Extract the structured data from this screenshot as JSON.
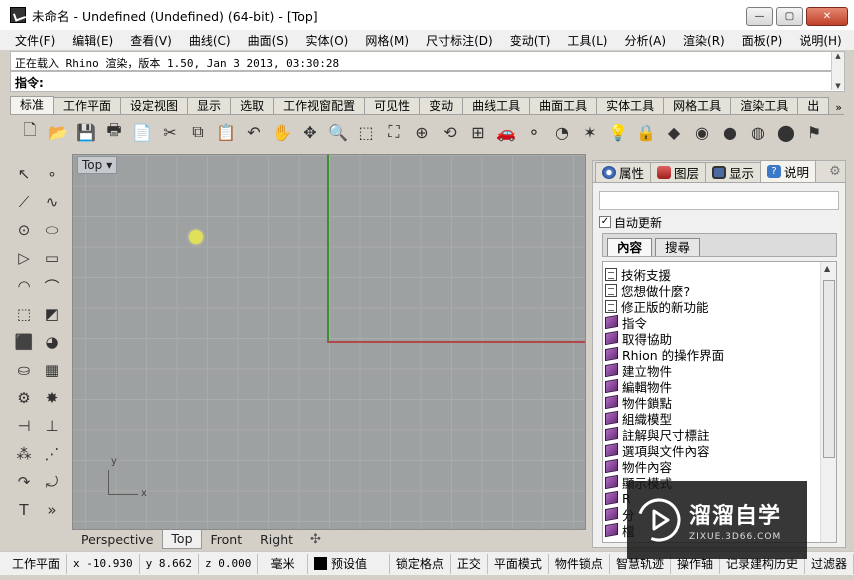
{
  "window": {
    "title": "未命名 - Undefined (Undefined) (64-bit) - [Top]",
    "buttons": {
      "minimize": "—",
      "maximize": "▢",
      "close": "✕"
    }
  },
  "menu": [
    "文件(F)",
    "编辑(E)",
    "查看(V)",
    "曲线(C)",
    "曲面(S)",
    "实体(O)",
    "网格(M)",
    "尺寸标注(D)",
    "变动(T)",
    "工具(L)",
    "分析(A)",
    "渲染(R)",
    "面板(P)",
    "说明(H)"
  ],
  "command": {
    "history": "正在载入 Rhino 渲染，版本 1.50, Jan  3 2013, 03:30:28",
    "prompt": "指令:"
  },
  "toolbar_tabs": {
    "items": [
      "标准",
      "工作平面",
      "设定视图",
      "显示",
      "选取",
      "工作视窗配置",
      "可见性",
      "变动",
      "曲线工具",
      "曲面工具",
      "实体工具",
      "网格工具",
      "渲染工具",
      "出"
    ],
    "active": "标准",
    "more": "»"
  },
  "main_tools": [
    {
      "name": "new-icon",
      "glyph": "🗋"
    },
    {
      "name": "open-icon",
      "glyph": "📂"
    },
    {
      "name": "save-icon",
      "glyph": "💾"
    },
    {
      "name": "print-icon",
      "glyph": "🖶"
    },
    {
      "name": "import-icon",
      "glyph": "📄"
    },
    {
      "name": "cut-icon",
      "glyph": "✂"
    },
    {
      "name": "copy-icon",
      "glyph": "⧉"
    },
    {
      "name": "paste-icon",
      "glyph": "📋"
    },
    {
      "name": "undo-icon",
      "glyph": "↶"
    },
    {
      "name": "pan-icon",
      "glyph": "✋"
    },
    {
      "name": "rotate-view-icon",
      "glyph": "✥"
    },
    {
      "name": "zoom-icon",
      "glyph": "🔍"
    },
    {
      "name": "zoom-window-icon",
      "glyph": "⬚"
    },
    {
      "name": "zoom-extents-icon",
      "glyph": "⛶"
    },
    {
      "name": "zoom-selected-icon",
      "glyph": "⊕"
    },
    {
      "name": "rotate-icon",
      "glyph": "⟲"
    },
    {
      "name": "four-view-icon",
      "glyph": "⊞"
    },
    {
      "name": "car-icon",
      "glyph": "🚗"
    },
    {
      "name": "point-icon",
      "glyph": "⚬"
    },
    {
      "name": "circle-icon",
      "glyph": "◔"
    },
    {
      "name": "snap-icon",
      "glyph": "✶"
    },
    {
      "name": "light-icon",
      "glyph": "💡"
    },
    {
      "name": "lock-icon",
      "glyph": "🔒"
    },
    {
      "name": "layer-icon",
      "glyph": "◆"
    },
    {
      "name": "color-wheel-icon",
      "glyph": "◉"
    },
    {
      "name": "sphere-icon",
      "glyph": "●"
    },
    {
      "name": "render-sphere-icon",
      "glyph": "◍"
    },
    {
      "name": "blue-sphere-icon",
      "glyph": "⬤"
    },
    {
      "name": "flag-icon",
      "glyph": "⚑"
    }
  ],
  "left_tools": [
    {
      "name": "select-arrow-icon",
      "glyph": "↖"
    },
    {
      "name": "point-tool-icon",
      "glyph": "∘"
    },
    {
      "name": "polyline-icon",
      "glyph": "⟋"
    },
    {
      "name": "curve-icon",
      "glyph": "∿"
    },
    {
      "name": "circle-tool-icon",
      "glyph": "⊙"
    },
    {
      "name": "ellipse-icon",
      "glyph": "⬭"
    },
    {
      "name": "polygon-icon",
      "glyph": "▷"
    },
    {
      "name": "rectangle-icon",
      "glyph": "▭"
    },
    {
      "name": "arc-icon",
      "glyph": "◠"
    },
    {
      "name": "fillet-icon",
      "glyph": "⌒"
    },
    {
      "name": "surface-icon",
      "glyph": "⬚"
    },
    {
      "name": "surface-edge-icon",
      "glyph": "◩"
    },
    {
      "name": "box-icon",
      "glyph": "⬛"
    },
    {
      "name": "solid-sphere-icon",
      "glyph": "◕"
    },
    {
      "name": "cylinder-icon",
      "glyph": "⛀"
    },
    {
      "name": "mesh-icon",
      "glyph": "▦"
    },
    {
      "name": "gear-tool-icon",
      "glyph": "⚙"
    },
    {
      "name": "explode-icon",
      "glyph": "✸"
    },
    {
      "name": "trim-icon",
      "glyph": "⊣"
    },
    {
      "name": "split-icon",
      "glyph": "⊥"
    },
    {
      "name": "group-icon",
      "glyph": "⁂"
    },
    {
      "name": "array-icon",
      "glyph": "⋰"
    },
    {
      "name": "move-icon",
      "glyph": "↷"
    },
    {
      "name": "rotate-tool-icon",
      "glyph": "⤾"
    },
    {
      "name": "text-icon",
      "glyph": "T"
    },
    {
      "name": "more-tools-icon",
      "glyph": "»"
    }
  ],
  "viewport": {
    "title": "Top",
    "axis_x_label": "x",
    "axis_y_label": "y",
    "tabs": [
      "Perspective",
      "Top",
      "Front",
      "Right"
    ],
    "active_tab": "Top",
    "add_tab": "✣"
  },
  "panel": {
    "tabs": [
      {
        "label": "属性",
        "name": "tab-properties",
        "color": "#5a7fc8"
      },
      {
        "label": "图层",
        "name": "tab-layers",
        "color": "#d04040"
      },
      {
        "label": "显示",
        "name": "tab-display",
        "color": "#4a6aa0"
      },
      {
        "label": "说明",
        "name": "tab-help",
        "color": "#3a78c8"
      }
    ],
    "active_tab": "说明",
    "auto_update": "自动更新",
    "content_tabs": [
      "內容",
      "搜尋"
    ],
    "active_content_tab": "內容",
    "tree": [
      {
        "label": "技術支援",
        "type": "doc"
      },
      {
        "label": "您想做什麼?",
        "type": "doc"
      },
      {
        "label": "修正版的新功能",
        "type": "doc"
      },
      {
        "label": "指令",
        "type": "book"
      },
      {
        "label": "取得協助",
        "type": "book"
      },
      {
        "label": "Rhion 的操作界面",
        "type": "book"
      },
      {
        "label": "建立物件",
        "type": "book"
      },
      {
        "label": "編輯物件",
        "type": "book"
      },
      {
        "label": "物件鎖點",
        "type": "book"
      },
      {
        "label": "組織模型",
        "type": "book"
      },
      {
        "label": "註解與尺寸標註",
        "type": "book"
      },
      {
        "label": "選項與文件內容",
        "type": "book"
      },
      {
        "label": "物件內容",
        "type": "book"
      },
      {
        "label": "顯示模式",
        "type": "book"
      },
      {
        "label": "R",
        "type": "book"
      },
      {
        "label": "分",
        "type": "book"
      },
      {
        "label": "檔",
        "type": "book"
      }
    ]
  },
  "status": {
    "cplane": "工作平面",
    "x": "x -10.930",
    "y": "y 8.662",
    "z": "z 0.000",
    "units": "毫米",
    "layer": "预设值",
    "toggles": [
      "锁定格点",
      "正交",
      "平面模式",
      "物件锁点",
      "智慧轨迹",
      "操作轴",
      "记录建构历史",
      "过滤器"
    ]
  },
  "watermark": {
    "title": "溜溜自学",
    "subtitle": "ZIXUE.3D66.COM"
  }
}
